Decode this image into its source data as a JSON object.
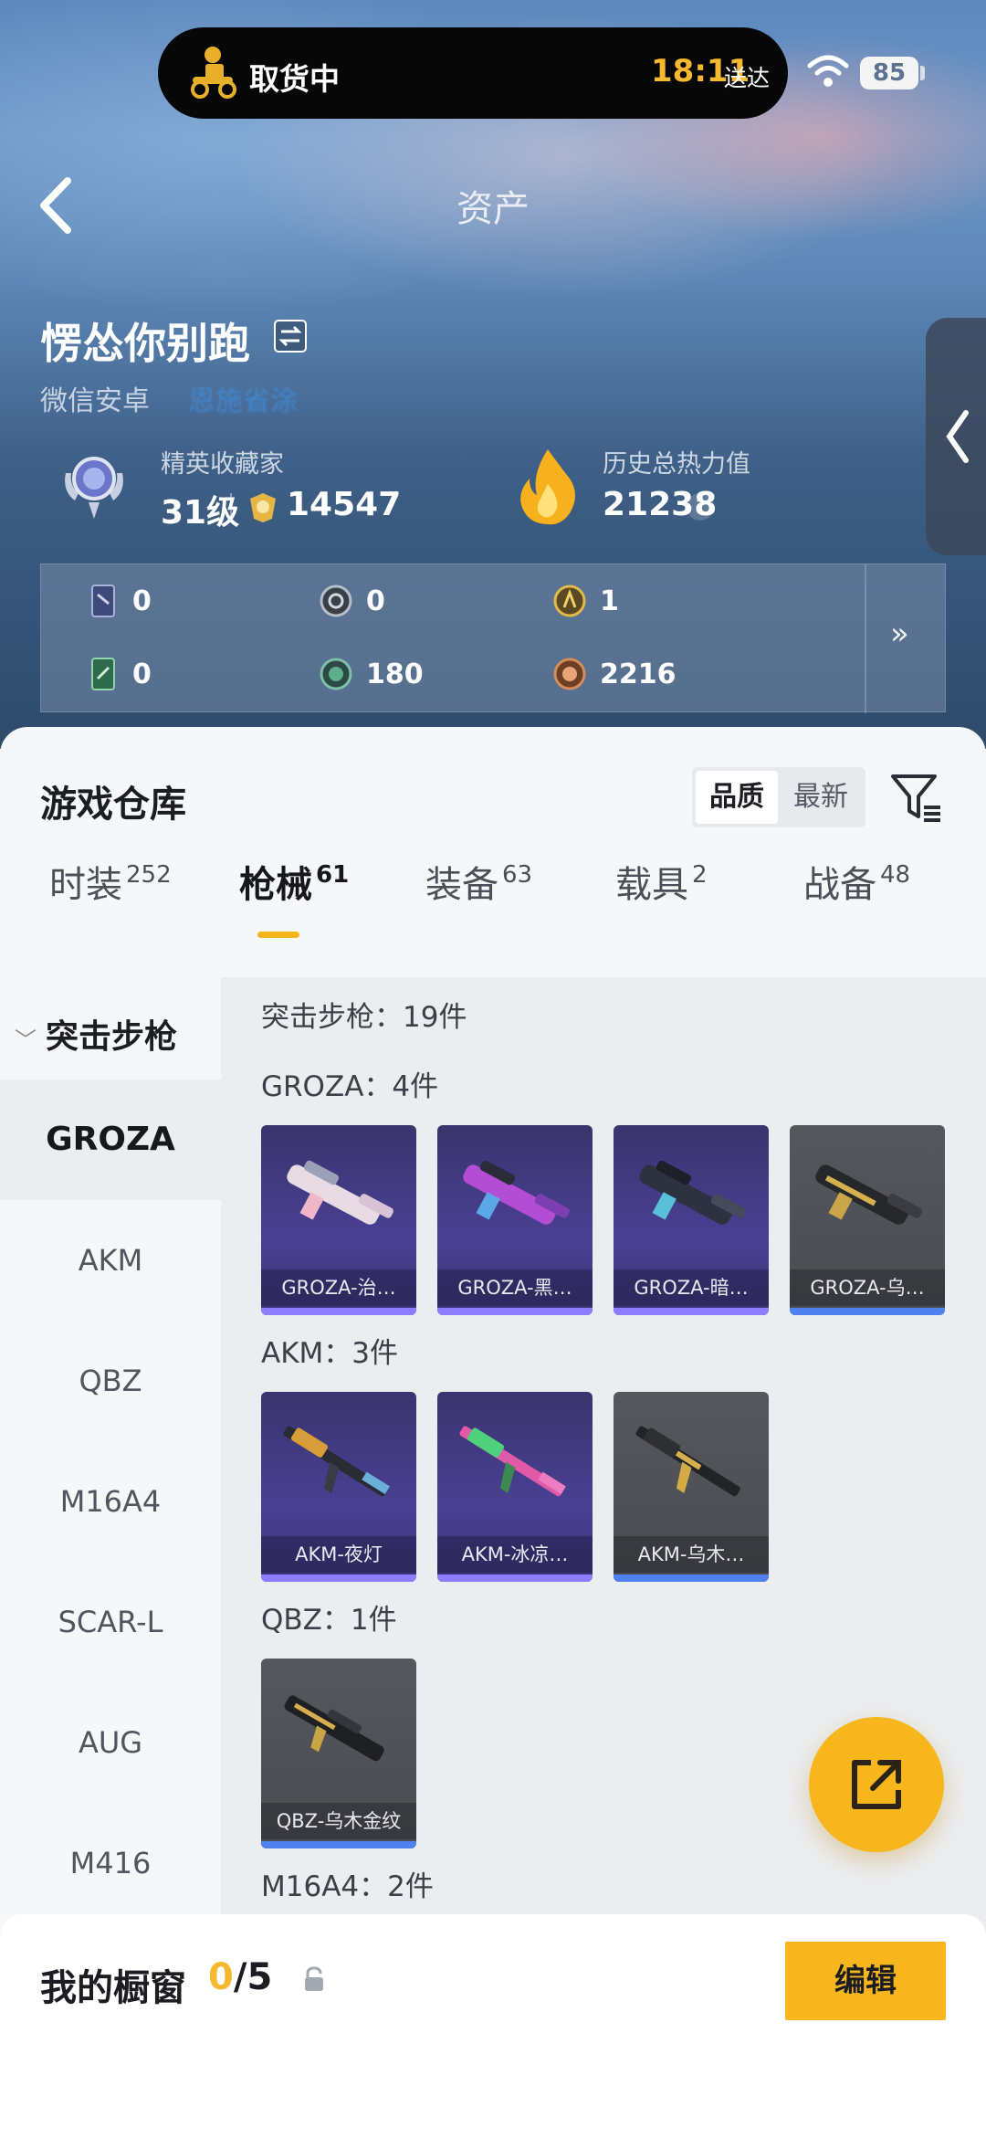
{
  "status_bar": {
    "delivery_status": "取货中",
    "time": "18:11",
    "delivery_suffix": "送达",
    "battery": "85",
    "icons": [
      "delivery-rider-icon",
      "wifi-icon",
      "battery-icon"
    ]
  },
  "nav": {
    "title": "资产",
    "back_icon": "chevron-left-icon"
  },
  "profile": {
    "name": "愣怂你别跑",
    "platform": "微信安卓",
    "server_blurred": "恩施省涂",
    "rank_title": "精英收藏家",
    "rank_level": "31级",
    "rank_score": "14547",
    "heat_title": "历史总热力值",
    "heat_value": "21238",
    "heat_help": "?"
  },
  "currencies": [
    {
      "icon": "card-blue-icon",
      "value": "0"
    },
    {
      "icon": "silver-coin-icon",
      "value": "0"
    },
    {
      "icon": "gold-coin-icon",
      "value": "1"
    },
    {
      "icon": "card-green-icon",
      "value": "0"
    },
    {
      "icon": "green-gem-icon",
      "value": "180"
    },
    {
      "icon": "bronze-coin-icon",
      "value": "2216"
    }
  ],
  "currency_more": "»",
  "warehouse": {
    "title": "游戏仓库",
    "sort_options": [
      "品质",
      "最新"
    ],
    "sort_selected": "品质",
    "tabs": [
      {
        "label": "时装",
        "count": "252"
      },
      {
        "label": "枪械",
        "count": "61"
      },
      {
        "label": "装备",
        "count": "63"
      },
      {
        "label": "载具",
        "count": "2"
      },
      {
        "label": "战备",
        "count": "48"
      }
    ],
    "active_tab": "枪械",
    "category_head": "突击步枪",
    "categories": [
      "GROZA",
      "AKM",
      "QBZ",
      "M16A4",
      "SCAR-L",
      "AUG",
      "M416"
    ],
    "active_category": "GROZA",
    "total_label": "突击步枪：19件",
    "sections": [
      {
        "label": "GROZA：4件",
        "items": [
          "GROZA-治…",
          "GROZA-黑…",
          "GROZA-暗…",
          "GROZA-乌…"
        ]
      },
      {
        "label": "AKM：3件",
        "items": [
          "AKM-夜灯",
          "AKM-冰凉…",
          "AKM-乌木…"
        ]
      },
      {
        "label": "QBZ：1件",
        "items": [
          "QBZ-乌木金纹"
        ]
      },
      {
        "label": "M16A4：2件",
        "items": []
      }
    ]
  },
  "showcase": {
    "label": "我的橱窗",
    "current": "0",
    "max": "/5",
    "edit_label": "编辑"
  },
  "colors": {
    "accent": "#f8b61d",
    "purple_card": "#4a3f93",
    "grey_card": "#4a4c52"
  }
}
